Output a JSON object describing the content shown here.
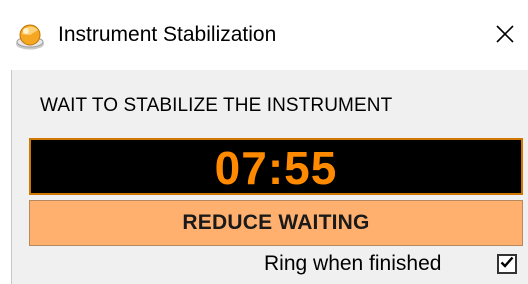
{
  "window": {
    "title": "Instrument Stabilization",
    "close_glyph": "×"
  },
  "dialog": {
    "instruction": "WAIT TO STABILIZE THE INSTRUMENT",
    "timer": "07:55",
    "reduce_button_label": "REDUCE WAITING",
    "ring_label": "Ring when finished",
    "ring_checked": true
  },
  "colors": {
    "timer_text": "#ff8a00",
    "timer_background": "#000000",
    "timer_border": "#d07800",
    "reduce_button_background": "#ffb06e",
    "client_background": "#f0f0f0"
  },
  "icons": {
    "app": "app-icon",
    "close": "close-icon",
    "check": "checkmark-icon"
  }
}
